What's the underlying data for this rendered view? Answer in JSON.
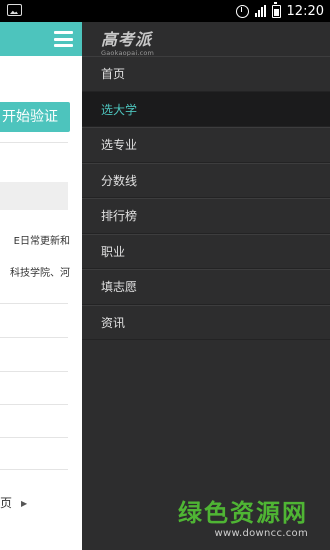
{
  "status_bar": {
    "time": "12:20",
    "icons": [
      "image-icon",
      "alarm-icon",
      "signal-icon",
      "battery-icon"
    ]
  },
  "main_content": {
    "verify_button_label": "开始验证",
    "text_line_1": "E日常更新和",
    "text_line_2": "科技学院、河",
    "pager_label": "页"
  },
  "drawer": {
    "logo_text": "高考派",
    "logo_sub": "Gaokaopai.com",
    "nav_items": [
      {
        "label": "首页"
      },
      {
        "label": "选大学",
        "active": true
      },
      {
        "label": "选专业"
      },
      {
        "label": "分数线"
      },
      {
        "label": "排行榜"
      },
      {
        "label": "职业"
      },
      {
        "label": "填志愿"
      },
      {
        "label": "资讯"
      }
    ]
  },
  "watermark": {
    "title": "绿色资源网",
    "url": "www.downcc.com"
  },
  "colors": {
    "accent": "#4dc4bd",
    "drawer_bg": "#2d2d2e",
    "active_bg": "#1b1b1c",
    "watermark_green": "#4fb534"
  }
}
